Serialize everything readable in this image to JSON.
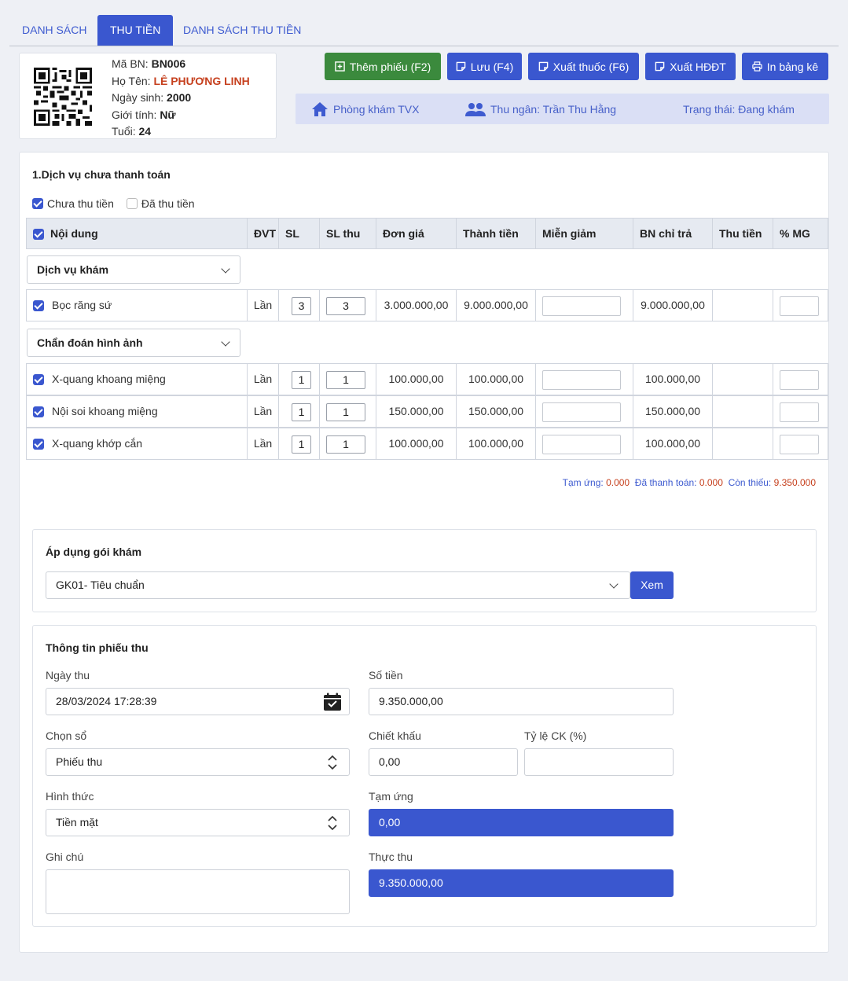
{
  "tabs": [
    {
      "label": "DANH SÁCH",
      "active": false
    },
    {
      "label": "THU TIỀN",
      "active": true
    },
    {
      "label": "DANH SÁCH THU TIỀN",
      "active": false
    }
  ],
  "patient": {
    "id_label": "Mã BN:",
    "id": "BN006",
    "name_label": "Họ Tên:",
    "name": "LÊ PHƯƠNG LINH",
    "dob_label": "Ngày sinh:",
    "dob": "2000",
    "gender_label": "Giới tính:",
    "gender": "Nữ",
    "age_label": "Tuổi:",
    "age": "24"
  },
  "toolbar": {
    "add": "Thêm phiếu (F2)",
    "save": "Lưu (F4)",
    "export_drug": "Xuất thuốc (F6)",
    "export_invoice": "Xuất HĐĐT",
    "print": "In bảng kê"
  },
  "infobar": {
    "clinic": "Phòng khám TVX",
    "cashier": "Thu ngân: Trần Thu Hằng",
    "status": "Trạng thái: Đang khám"
  },
  "services": {
    "title": "1.Dịch vụ chưa thanh toán",
    "filter_unpaid": "Chưa thu tiền",
    "filter_paid": "Đã thu tiền",
    "headers": [
      "Nội dung",
      "ĐVT",
      "SL",
      "SL thu",
      "Đơn giá",
      "Thành tiền",
      "Miễn giảm",
      "BN chỉ trả",
      "Thu tiền",
      "% MG"
    ],
    "groups": [
      {
        "name": "Dịch vụ khám",
        "rows": [
          {
            "name": "Bọc răng sứ",
            "unit": "Lần",
            "qty": "3",
            "qty_paid": "3",
            "price": "3.000.000,00",
            "total": "9.000.000,00",
            "patient_pays": "9.000.000,00"
          }
        ]
      },
      {
        "name": "Chẩn đoán hình ảnh",
        "rows": [
          {
            "name": "X-quang khoang miệng",
            "unit": "Lần",
            "qty": "1",
            "qty_paid": "1",
            "price": "100.000,00",
            "total": "100.000,00",
            "patient_pays": "100.000,00"
          },
          {
            "name": "Nội soi khoang miệng",
            "unit": "Lần",
            "qty": "1",
            "qty_paid": "1",
            "price": "150.000,00",
            "total": "150.000,00",
            "patient_pays": "150.000,00"
          },
          {
            "name": "X-quang khớp cắn",
            "unit": "Lần",
            "qty": "1",
            "qty_paid": "1",
            "price": "100.000,00",
            "total": "100.000,00",
            "patient_pays": "100.000,00"
          }
        ]
      }
    ],
    "totals": {
      "advance_label": "Tạm ứng:",
      "advance": "0.000",
      "paid_label": "Đã thanh toán:",
      "paid": "0.000",
      "remaining_label": "Còn thiếu:",
      "remaining": "9.350.000"
    }
  },
  "package": {
    "title": "Áp dụng gói khám",
    "selected": "GK01- Tiêu chuẩn",
    "view_button": "Xem"
  },
  "receipt": {
    "title": "Thông tin phiếu thu",
    "date_label": "Ngày thu",
    "date": "28/03/2024 17:28:39",
    "amount_label": "Số tiền",
    "amount": "9.350.000,00",
    "book_label": "Chọn sổ",
    "book": "Phiếu thu",
    "discount_label": "Chiết khấu",
    "discount": "0,00",
    "discount_rate_label": "Tỷ lệ CK (%)",
    "discount_rate": "",
    "method_label": "Hình thức",
    "method": "Tiền mặt",
    "advance_label": "Tạm ứng",
    "advance": "0,00",
    "note_label": "Ghi chú",
    "note": "",
    "actual_label": "Thực thu",
    "actual": "9.350.000,00"
  },
  "colors": {
    "primary": "#3a57cf",
    "success": "#3b8a3d",
    "danger": "#c6401e",
    "info_bg": "#dadff5"
  }
}
